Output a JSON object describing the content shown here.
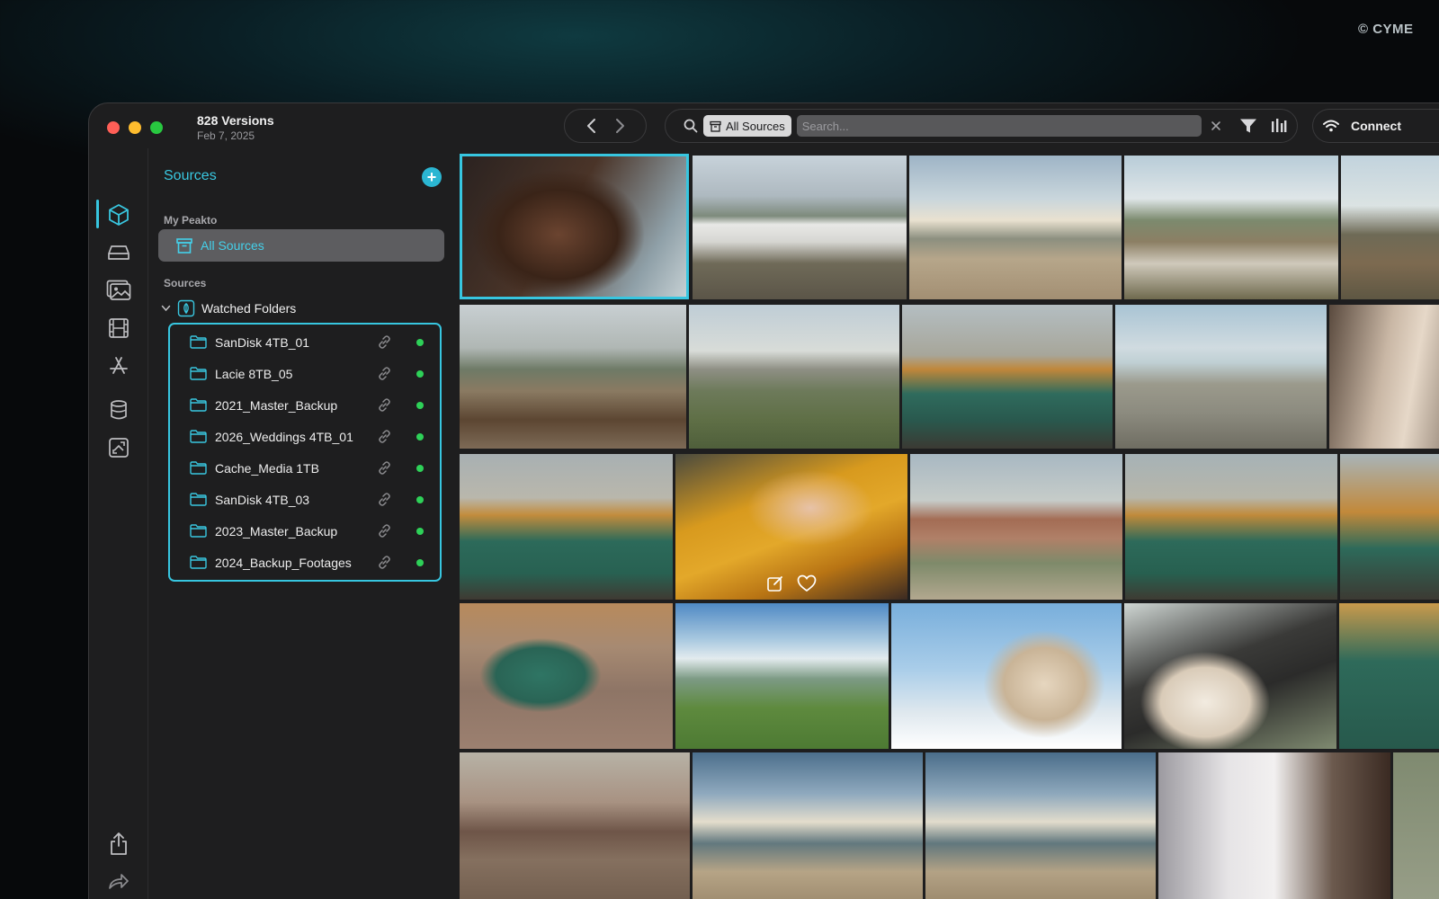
{
  "watermark": "© CYME",
  "window": {
    "title": "828 Versions",
    "date": "Feb 7, 2025"
  },
  "toolbar": {
    "chip_label": "All Sources",
    "search_placeholder": "Search...",
    "connect_label": "Connect"
  },
  "rail": [
    "cube-icon",
    "drive-icon",
    "photos-icon",
    "film-icon",
    "app-store-icon",
    "database-icon",
    "photo-sync-icon",
    "share-icon",
    "forward-icon"
  ],
  "sidebar": {
    "title": "Sources",
    "section_my": "My Peakto",
    "all_sources": "All Sources",
    "section_sources": "Sources",
    "watched_folders": "Watched Folders",
    "folders": [
      "SanDisk 4TB_01",
      "Lacie 8TB_05",
      "2021_Master_Backup",
      "2026_Weddings 4TB_01",
      "Cache_Media 1TB",
      "SanDisk 4TB_03",
      "2023_Master_Backup",
      "2024_Backup_Footages"
    ]
  },
  "accent_color": "#37c6e0",
  "status_color": "#2ed158"
}
